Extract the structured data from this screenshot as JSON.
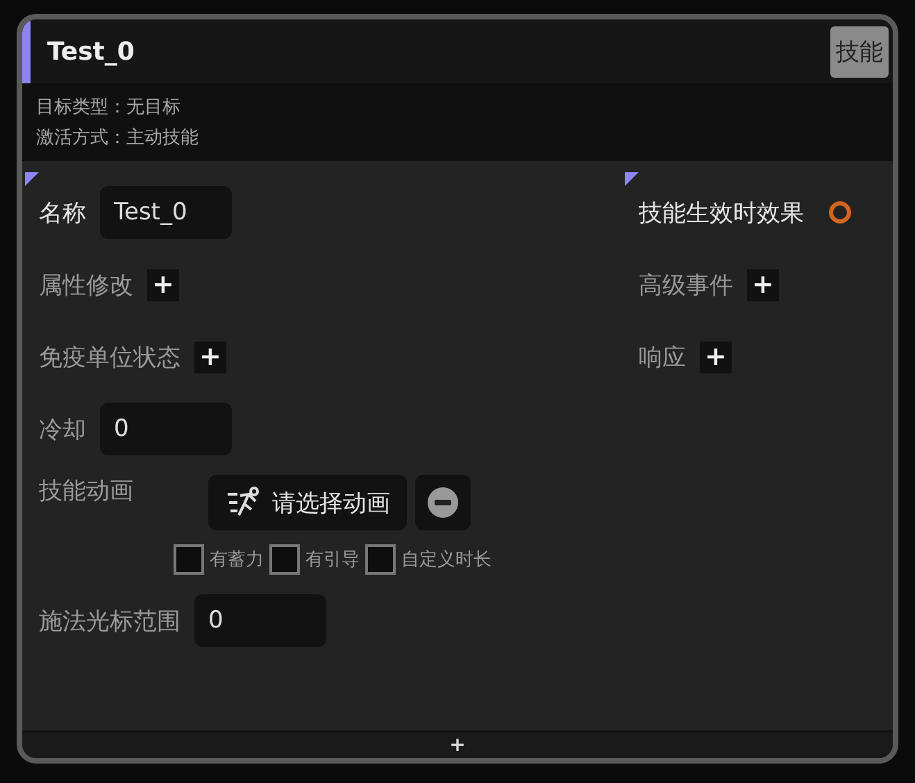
{
  "node": {
    "title": "Test_0",
    "badge": "技能",
    "info": [
      "目标类型：无目标",
      "激活方式：主动技能"
    ],
    "left": [
      {
        "kind": "field",
        "label": "名称",
        "value": "Test_0",
        "highlighted": true
      },
      {
        "kind": "add",
        "label": "属性修改",
        "button": "+",
        "highlighted": false
      },
      {
        "kind": "add",
        "label": "免疫单位状态",
        "button": "+",
        "highlighted": false
      },
      {
        "kind": "field",
        "label": "冷却",
        "value": "0",
        "highlighted": false
      },
      {
        "kind": "picker",
        "label": "技能动画",
        "button": "请选择动画",
        "highlighted": false,
        "options": [
          {
            "label": "有蓄力",
            "checked": false
          },
          {
            "label": "有引导",
            "checked": false
          },
          {
            "label": "自定义时长",
            "checked": false
          }
        ]
      },
      {
        "kind": "wide-field",
        "label": "施法光标范围",
        "value": "0",
        "highlighted": false
      }
    ],
    "right": [
      {
        "kind": "output",
        "label": "技能生效时效果",
        "highlighted": true
      },
      {
        "kind": "add",
        "label": "高级事件",
        "button": "+",
        "highlighted": false
      },
      {
        "kind": "add",
        "label": "响应",
        "button": "+",
        "highlighted": false
      }
    ],
    "footer_button": "+"
  }
}
